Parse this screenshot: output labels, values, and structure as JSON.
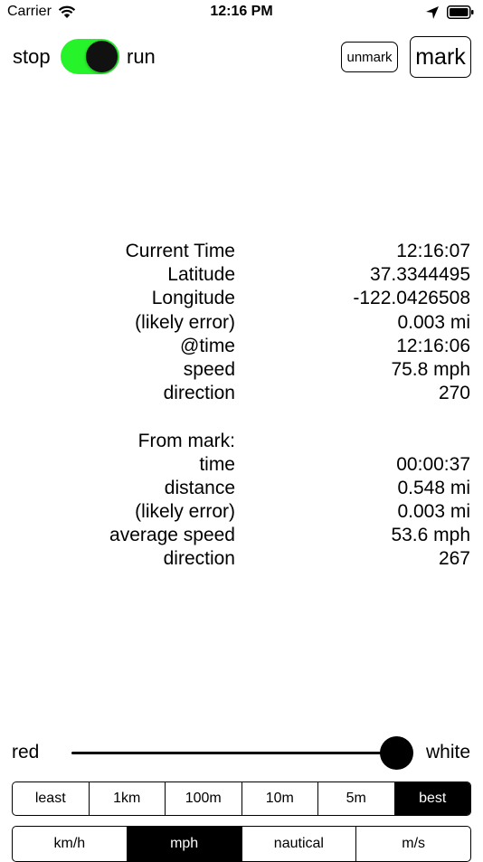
{
  "status": {
    "carrier": "Carrier",
    "time": "12:16 PM"
  },
  "controls": {
    "stop_label": "stop",
    "run_label": "run",
    "run_on": true,
    "unmark_label": "unmark",
    "mark_label": "mark",
    "toggle_color": "#27f32b"
  },
  "current": [
    {
      "label": "Current Time",
      "value": "12:16:07"
    },
    {
      "label": "Latitude",
      "value": "37.3344495"
    },
    {
      "label": "Longitude",
      "value": "-122.0426508"
    },
    {
      "label": "(likely error)",
      "value": "0.003 mi"
    },
    {
      "label": "@time",
      "value": "12:16:06"
    },
    {
      "label": "speed",
      "value": "75.8 mph"
    },
    {
      "label": "direction",
      "value": "270"
    }
  ],
  "from_mark": {
    "heading": "From mark:",
    "rows": [
      {
        "label": "time",
        "value": "00:00:37"
      },
      {
        "label": "distance",
        "value": "0.548 mi"
      },
      {
        "label": "(likely error)",
        "value": "0.003 mi"
      },
      {
        "label": "average speed",
        "value": "53.6 mph"
      },
      {
        "label": "direction",
        "value": "267"
      }
    ]
  },
  "slider": {
    "min_label": "red",
    "max_label": "white",
    "value": 0.95
  },
  "accuracy": {
    "options": [
      "least",
      "1km",
      "100m",
      "10m",
      "5m",
      "best"
    ],
    "selected": 5
  },
  "units": {
    "options": [
      "km/h",
      "mph",
      "nautical",
      "m/s"
    ],
    "selected": 1
  }
}
